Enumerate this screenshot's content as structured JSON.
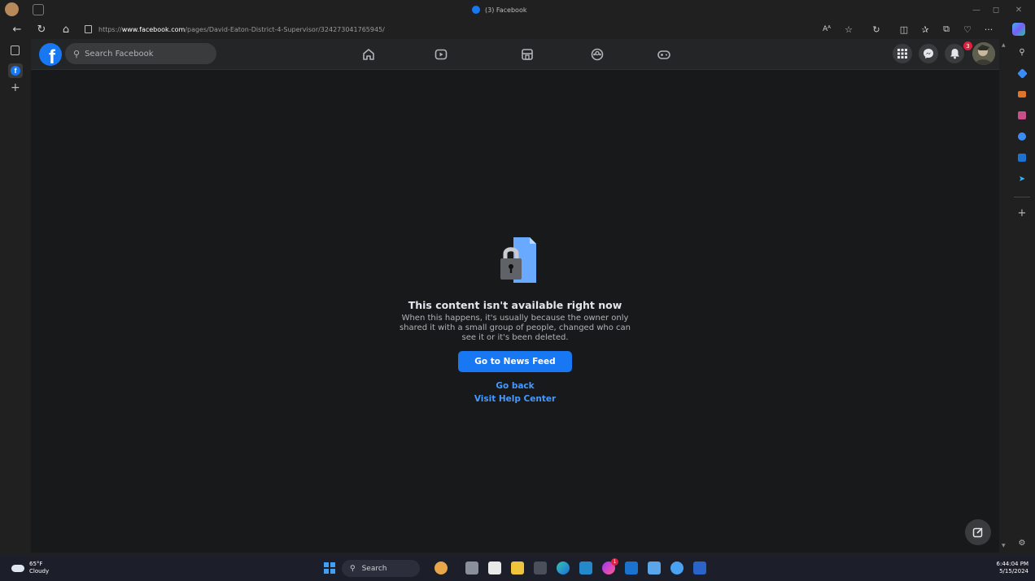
{
  "browser": {
    "tab_title": "(3) Facebook",
    "url_prefix": "https://",
    "url_host": "www.facebook.com",
    "url_path": "/pages/David-Eaton-District-4-Supervisor/324273041765945/"
  },
  "facebook": {
    "search_placeholder": "Search Facebook",
    "notification_count": "3",
    "message": {
      "title": "This content isn't available right now",
      "body": "When this happens, it's usually because the owner only shared it with a small group of people, changed who can see it or it's been deleted.",
      "primary_button": "Go to News Feed",
      "go_back": "Go back",
      "help_center": "Visit Help Center"
    }
  },
  "taskbar": {
    "temperature": "65°F",
    "condition": "Cloudy",
    "search_label": "Search",
    "time": "6:44:04 PM",
    "date": "5/15/2024",
    "messenger_badge": "1"
  },
  "colors": {
    "fb_blue": "#1877f2",
    "link_blue": "#4599ff",
    "content_bg": "#18191a"
  }
}
